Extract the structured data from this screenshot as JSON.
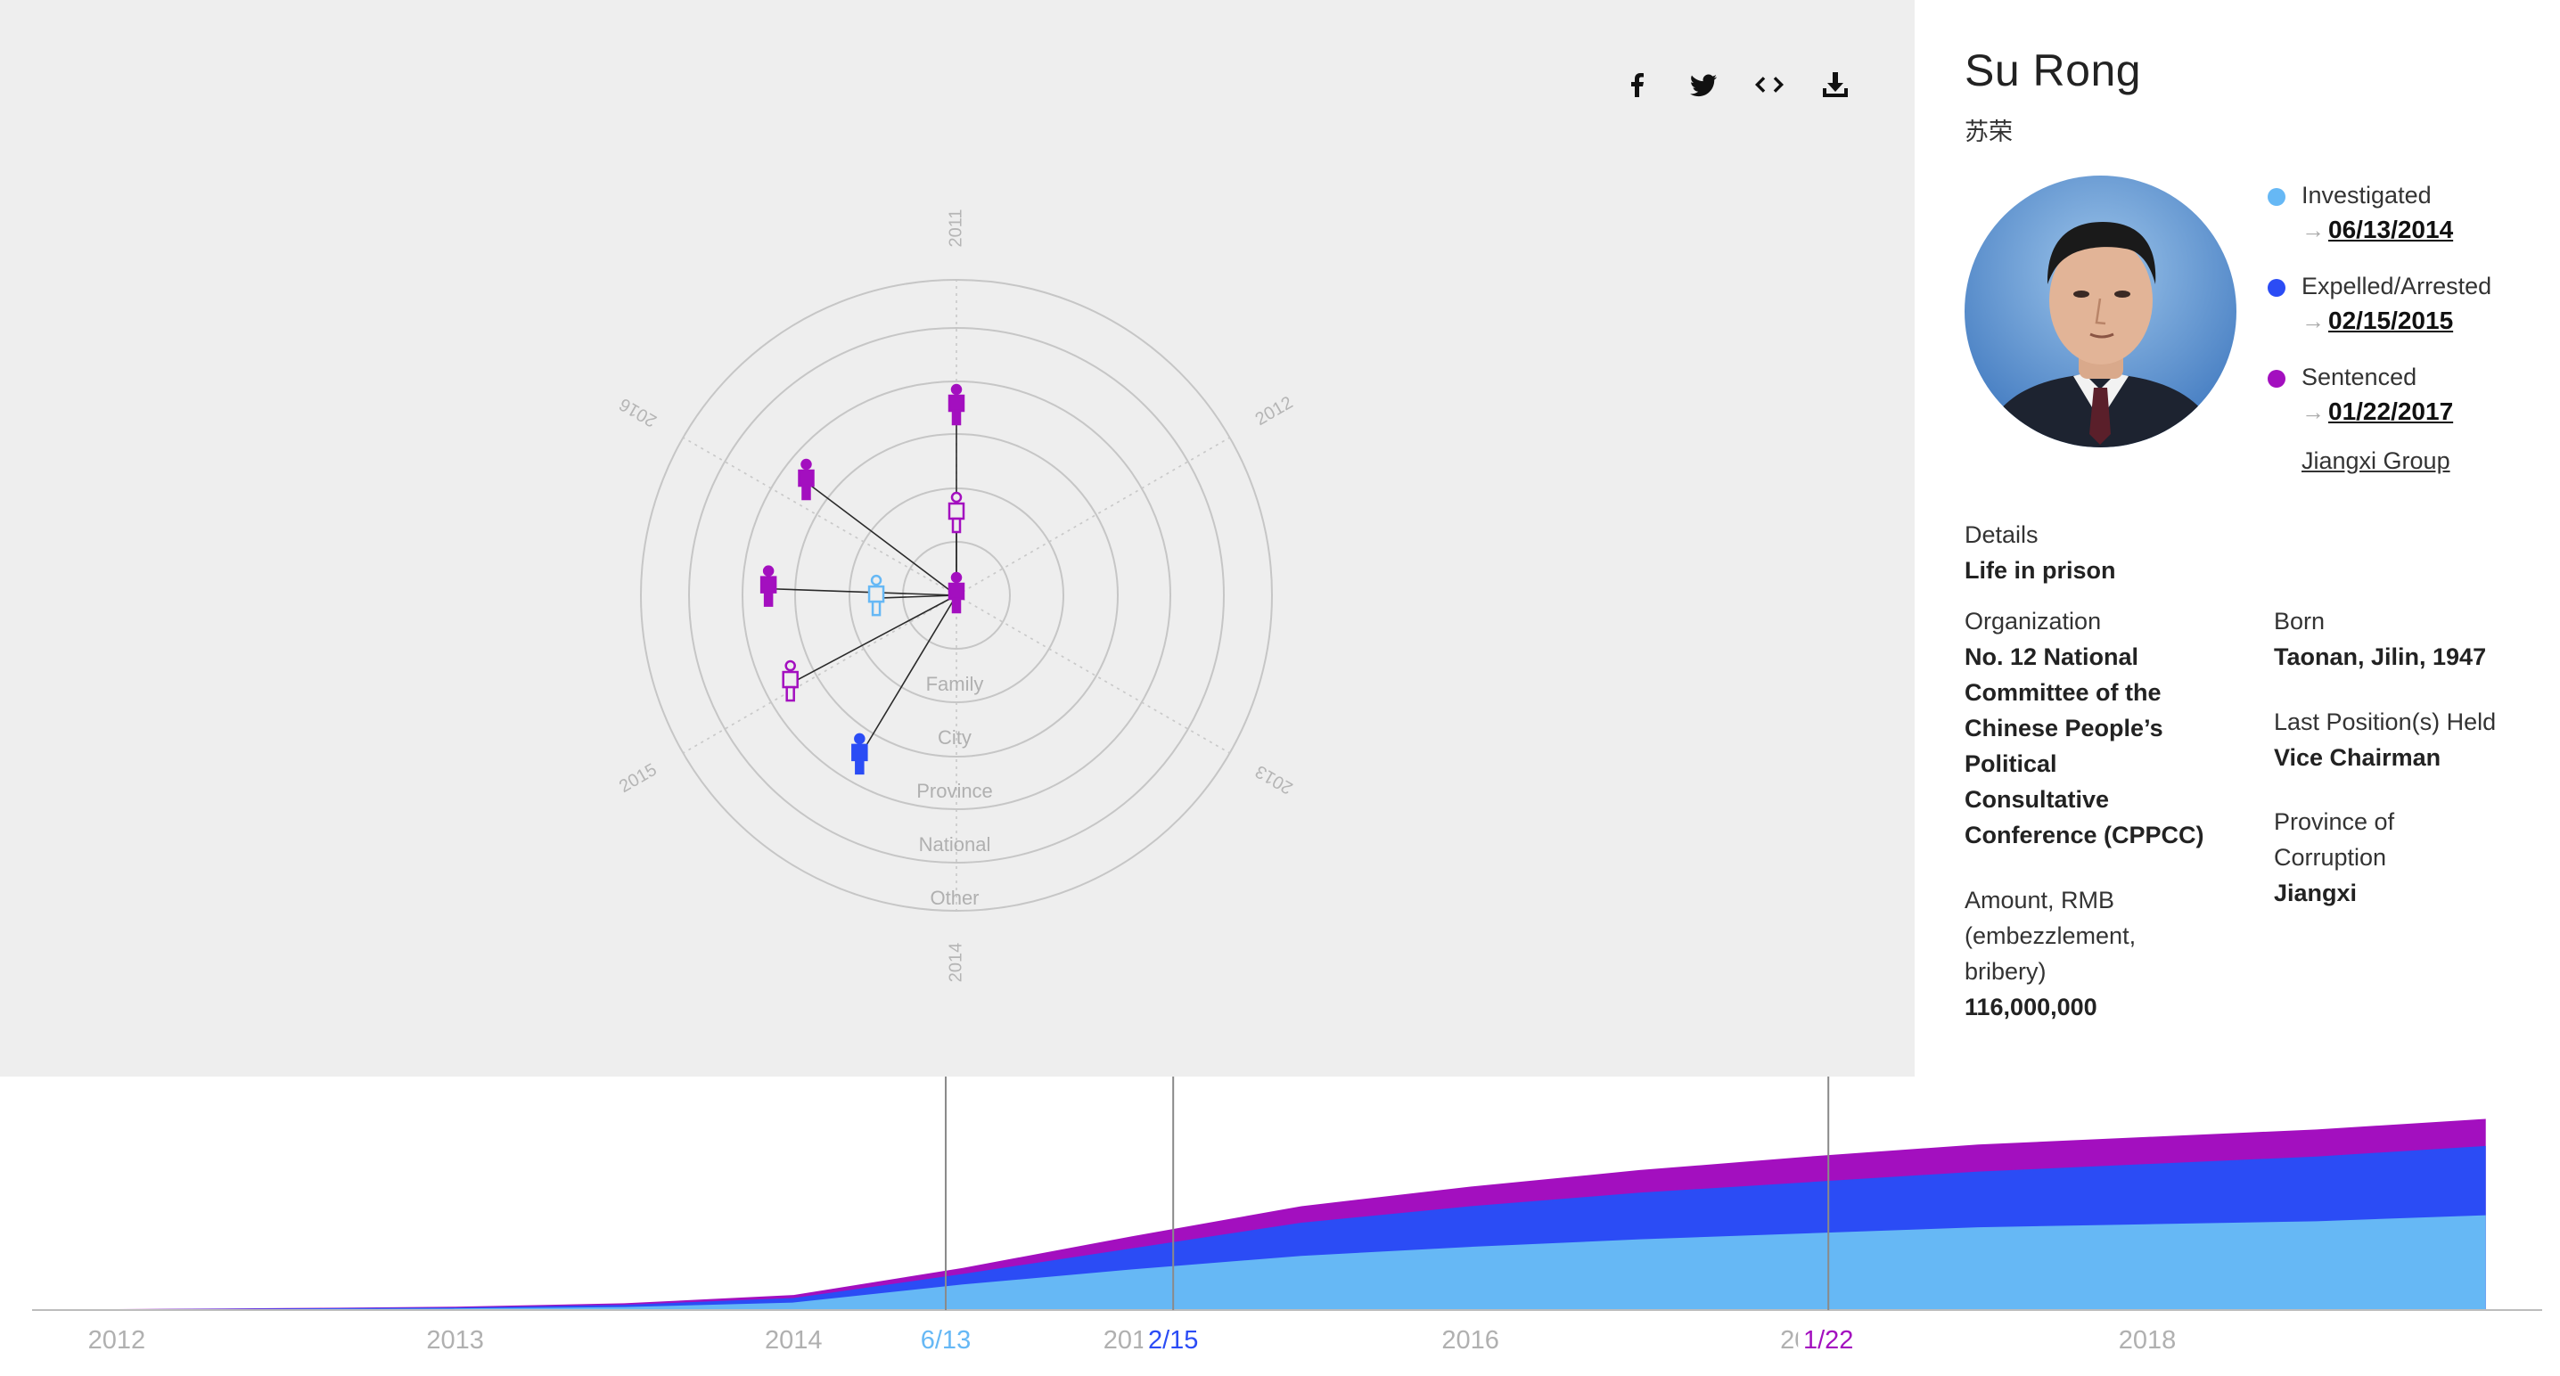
{
  "share": {
    "facebook_icon": "facebook-icon",
    "twitter_icon": "twitter-icon",
    "embed_icon": "embed-code-icon",
    "download_icon": "download-icon"
  },
  "radial": {
    "year_labels": [
      "2011",
      "2012",
      "2013",
      "2014",
      "2015",
      "2016"
    ],
    "ring_labels": [
      "Family",
      "City",
      "Province",
      "National",
      "Other"
    ],
    "nodes": [
      {
        "ring": 3,
        "angle_deg": 0,
        "status": "sentenced",
        "filled": true
      },
      {
        "ring": 1,
        "angle_deg": 0,
        "status": "sentenced",
        "filled": false
      },
      {
        "ring": 3,
        "angle_deg": 307,
        "status": "sentenced",
        "filled": true
      },
      {
        "ring": 3,
        "angle_deg": 272,
        "status": "sentenced",
        "filled": true
      },
      {
        "ring": 3,
        "angle_deg": 242,
        "status": "sentenced",
        "filled": false
      },
      {
        "ring": 3,
        "angle_deg": 211,
        "status": "expelled",
        "filled": true
      },
      {
        "ring": 1,
        "angle_deg": 268,
        "status": "investigated",
        "filled": false
      },
      {
        "ring": 0,
        "angle_deg": 0,
        "status": "sentenced",
        "filled": true
      }
    ]
  },
  "person": {
    "name_en": "Su Rong",
    "name_zh": "苏荣",
    "portrait_alt": "Portrait of Su Rong",
    "legend": [
      {
        "label": "Investigated",
        "date": "06/13/2014",
        "color": "#66b8f5"
      },
      {
        "label": "Expelled/Arrested",
        "date": "02/15/2015",
        "color": "#2b4cf5"
      },
      {
        "label": "Sentenced",
        "date": "01/22/2017",
        "color": "#a30fbf"
      }
    ],
    "group_link": "Jiangxi Group",
    "arrow": "→",
    "details": {
      "details_label": "Details",
      "details_value": "Life in prison",
      "org_label": "Organization",
      "org_value_lines": [
        "No. 12 National",
        "Committee of the",
        "Chinese People’s",
        "Political",
        "Consultative",
        "Conference (CPPCC)"
      ],
      "amount_label_lines": [
        "Amount, RMB",
        "(embezzlement,",
        "bribery)"
      ],
      "amount_value": "116,000,000",
      "born_label": "Born",
      "born_value": "Taonan, Jilin, 1947",
      "position_label": "Last Position(s) Held",
      "position_value": "Vice Chairman",
      "province_label_lines": [
        "Province of",
        "Corruption"
      ],
      "province_value": "Jiangxi"
    }
  },
  "chart_data": {
    "type": "area",
    "x_start": "2011-12",
    "x_end": "2019-02",
    "xlim": [
      "2011-10",
      "2019-03"
    ],
    "tick_labels": [
      "2012",
      "2013",
      "2014",
      "2015",
      "2016",
      "2017",
      "2018"
    ],
    "x": [
      "2012-01",
      "2012-07",
      "2013-01",
      "2013-07",
      "2014-01",
      "2014-07",
      "2015-01",
      "2015-07",
      "2016-01",
      "2016-07",
      "2017-01",
      "2017-07",
      "2018-01",
      "2018-07",
      "2019-01"
    ],
    "series": [
      {
        "color": "#66b8f5",
        "values": [
          0.3,
          0.6,
          1,
          2,
          5,
          17,
          27,
          36,
          42,
          47,
          51,
          55,
          57,
          59,
          63
        ]
      },
      {
        "color": "#2b4cf5",
        "values": [
          0.2,
          0.4,
          0.7,
          1.5,
          3,
          7,
          14,
          22,
          27,
          31,
          34,
          37,
          40,
          43,
          46
        ]
      },
      {
        "color": "#a30fbf",
        "values": [
          0.1,
          0.3,
          0.5,
          1,
          2,
          4,
          8,
          11,
          13,
          15,
          17,
          18,
          18,
          18,
          18
        ]
      }
    ],
    "ylim": [
      0,
      135
    ],
    "markers": [
      {
        "label": "6/13",
        "date": "2014-06-13",
        "color": "#66b8f5"
      },
      {
        "label": "2/15",
        "date": "2015-02-15",
        "color": "#2b4cf5"
      },
      {
        "label": "1/22",
        "date": "2017-01-22",
        "color": "#a30fbf"
      }
    ]
  }
}
